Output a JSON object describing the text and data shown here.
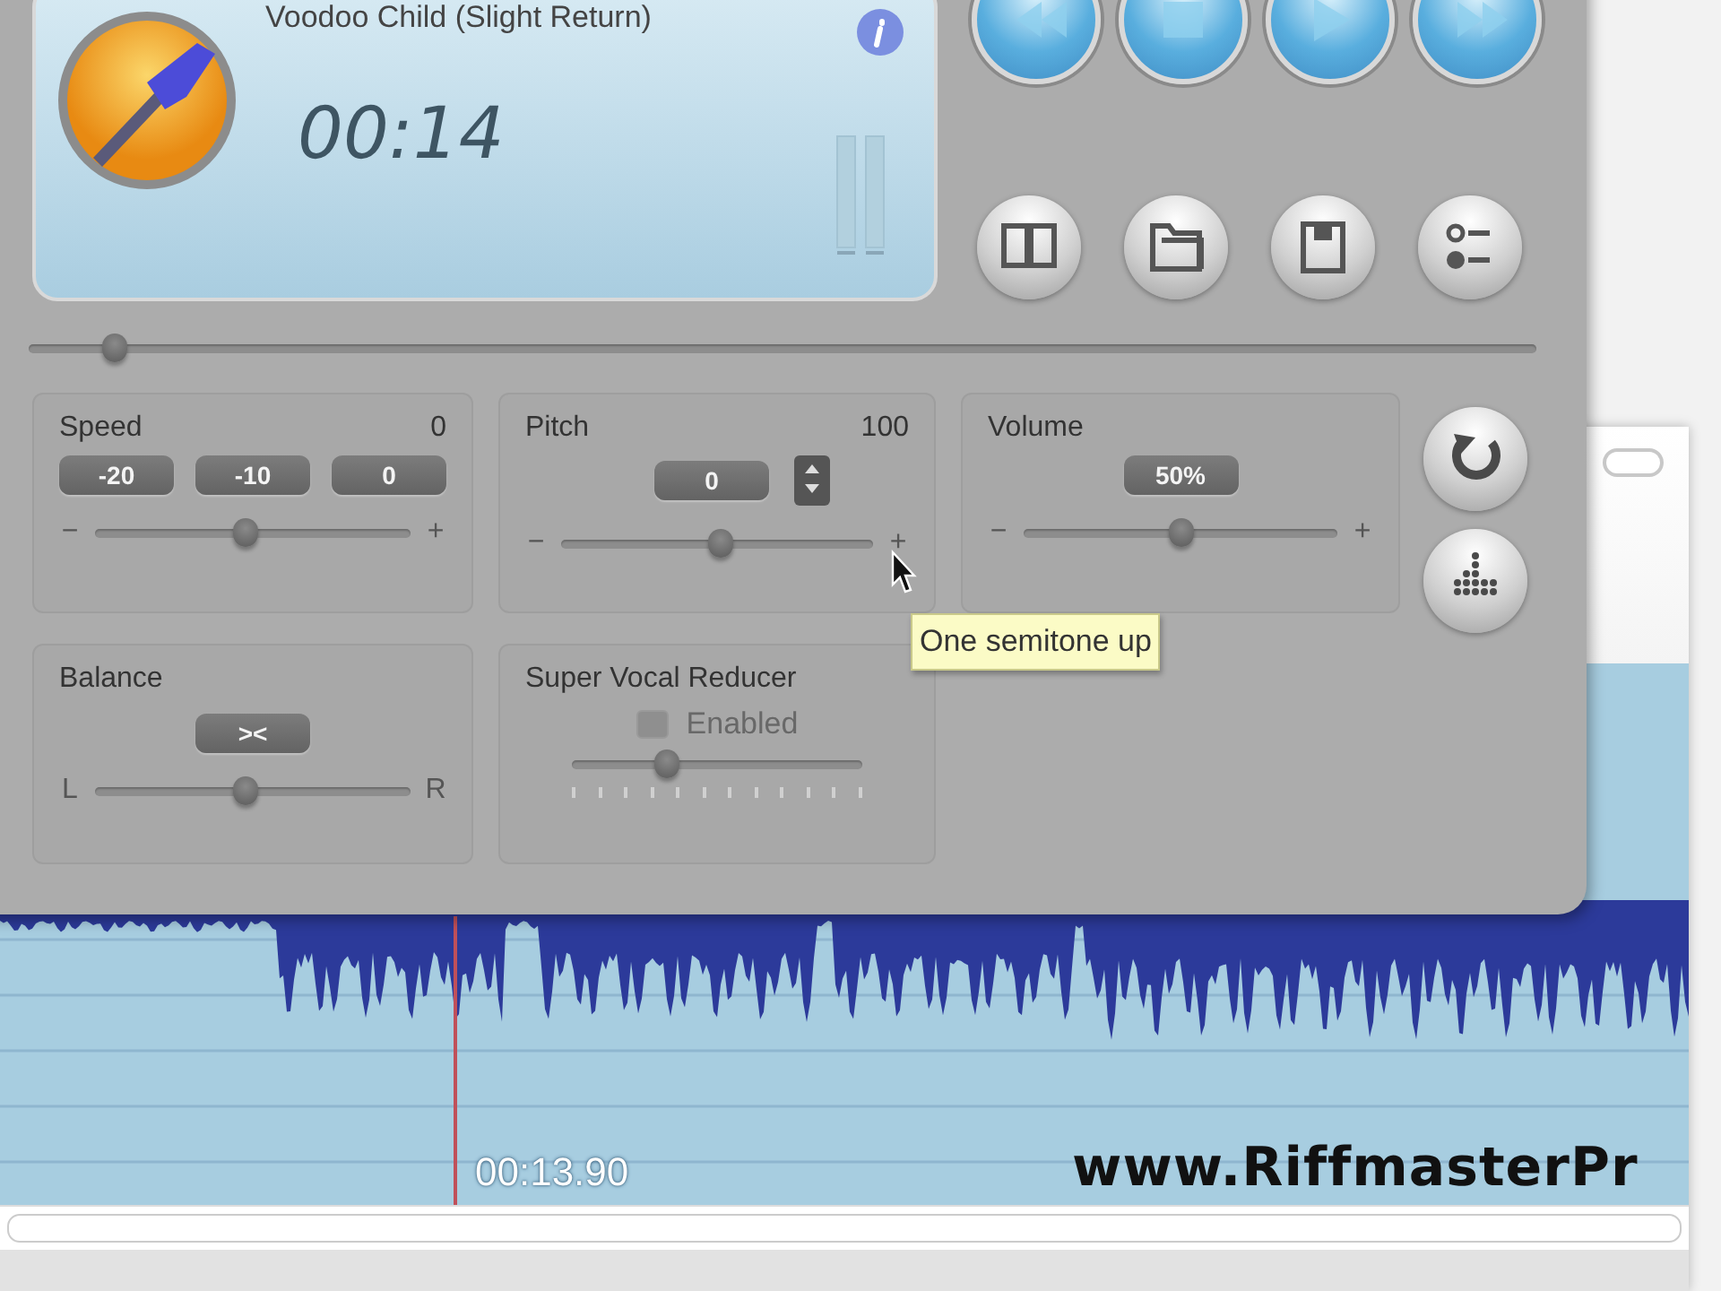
{
  "track": {
    "title": "Voodoo Child (Slight Return)",
    "time": "00:14"
  },
  "position": {
    "level": 0.057
  },
  "controls": [
    {
      "kind": "speed",
      "label": "Speed",
      "value": "0",
      "presets": [
        "-20",
        "-10",
        "0"
      ],
      "min_label": "−",
      "max_label": "+",
      "level": 0.48
    },
    {
      "kind": "pitch",
      "label": "Pitch",
      "value": "100",
      "field": "0",
      "min_label": "−",
      "max_label": "+",
      "level": 0.51
    },
    {
      "kind": "volume",
      "label": "Volume",
      "field": "50%",
      "min_label": "−",
      "max_label": "+",
      "level": 0.5
    },
    {
      "kind": "balance",
      "label": "Balance",
      "button": "><",
      "min_label": "L",
      "max_label": "R",
      "level": 0.48
    },
    {
      "kind": "vocal",
      "label": "Super Vocal Reducer",
      "checkbox": {
        "label": "Enabled",
        "checked": false,
        "disabled": true
      },
      "level": 0.33
    }
  ],
  "tooltip": "One semitone up",
  "waveform": {
    "time": "00:13.90"
  },
  "overlay_text": "www.RiffmasterPr"
}
